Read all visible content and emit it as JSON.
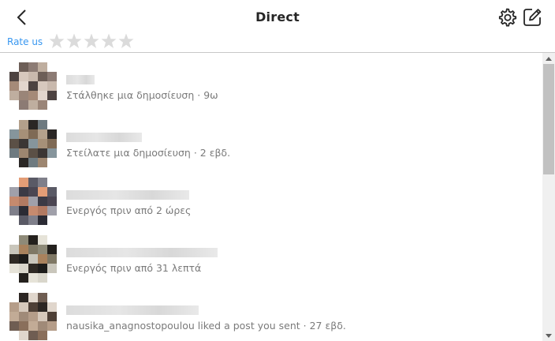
{
  "header": {
    "title": "Direct",
    "back_icon": "chevron-left-icon",
    "settings_icon": "gear-icon",
    "compose_icon": "compose-edit-icon"
  },
  "rating": {
    "label": "Rate us",
    "stars": 5,
    "filled": 0,
    "star_color": "#dbdbdb"
  },
  "accent_color": "#3897f0",
  "conversations": [
    {
      "preview": "Στάλθηκε μια δημοσίευση · 9ω",
      "palette": [
        "#c9b9ad",
        "#a58a78",
        "#6d5e57",
        "#e3d6cd",
        "#8c7b74",
        "#4d4341",
        "#bfae9f",
        "#d7c8bd",
        "#9a8578"
      ]
    },
    {
      "preview": "Στείλατε μια δημοσίευση · 2 εβδ.",
      "palette": [
        "#9d8670",
        "#7f6a55",
        "#5b5046",
        "#b3a08b",
        "#3b3634",
        "#2a2725",
        "#86959c",
        "#6e7a80",
        "#a69078"
      ]
    },
    {
      "preview": "Ενεργός πριν από 2 ώρες",
      "palette": [
        "#3b3a45",
        "#2b2b34",
        "#4b4652",
        "#c68a6e",
        "#e39d76",
        "#b27a62",
        "#5a5a66",
        "#a0a0aa",
        "#7f7f8a"
      ]
    },
    {
      "preview": "Ενεργός πριν από 31 λεπτά",
      "palette": [
        "#e6e3d8",
        "#a9825d",
        "#d9d6cb",
        "#7f7865",
        "#2f2a24",
        "#8e8a78",
        "#1d1c1a",
        "#24211d",
        "#c9c6bb"
      ]
    },
    {
      "preview": "nausika_anagnostopoulou liked a post you sent · 27 εβδ.",
      "palette": [
        "#b59d89",
        "#6f5d52",
        "#d6c8bb",
        "#8a6f5b",
        "#4e3f36",
        "#c2ab96",
        "#2c2623",
        "#a08a78",
        "#e0d6cc"
      ]
    }
  ]
}
